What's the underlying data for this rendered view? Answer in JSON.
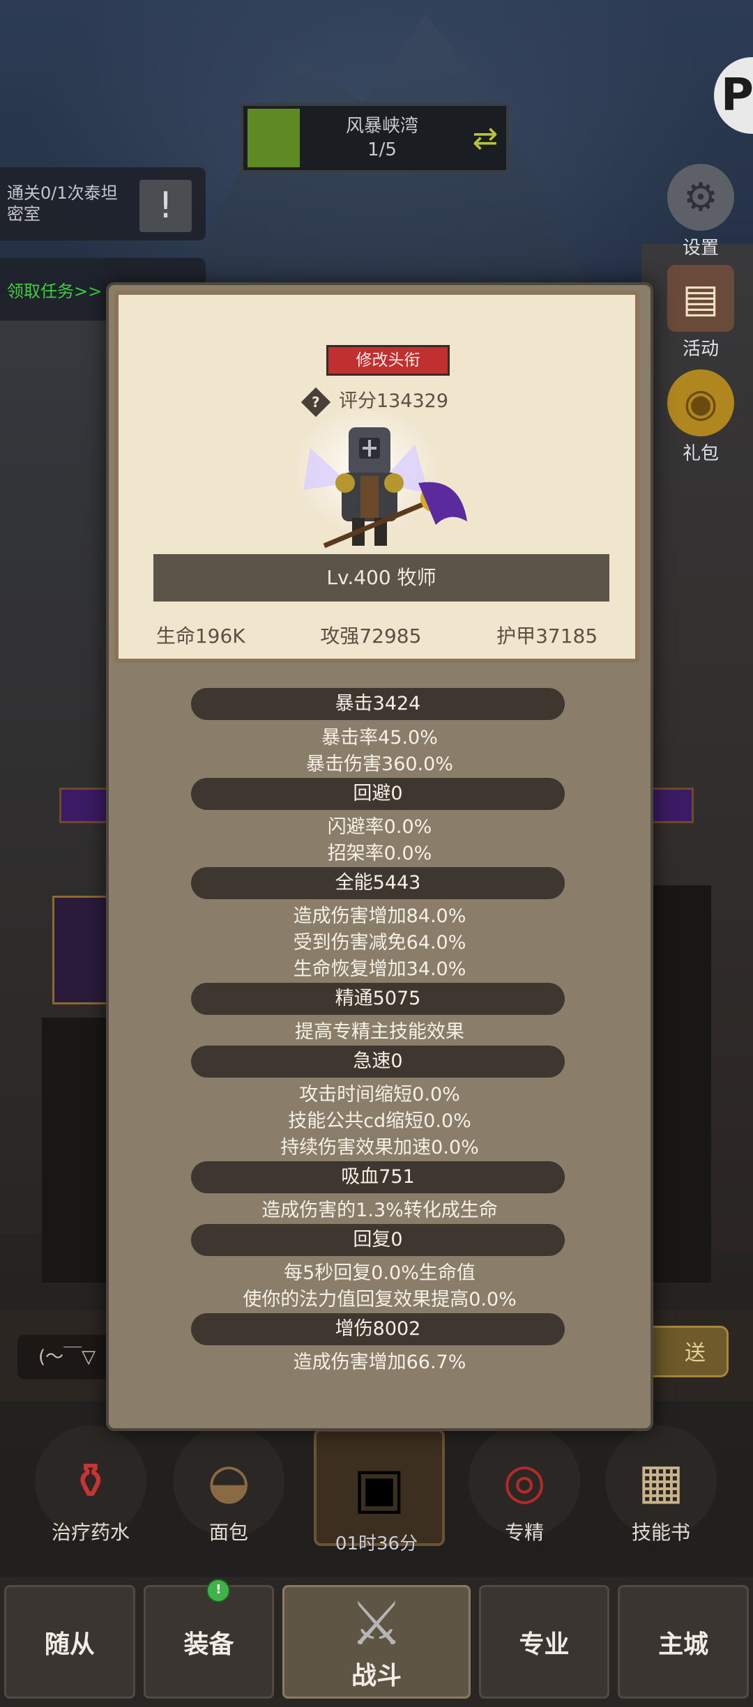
{
  "stage": {
    "name": "风暴峡湾",
    "progress": "1/5"
  },
  "quest": {
    "text": "通关0/1次泰坦密室",
    "icon": "exclamation-icon"
  },
  "task": {
    "text": "领取任务>>"
  },
  "side_menu": [
    {
      "label": "设置",
      "icon": "gear-icon"
    },
    {
      "label": "活动",
      "icon": "scroll-icon"
    },
    {
      "label": "礼包",
      "icon": "gift-icon"
    }
  ],
  "corner_badge": "P",
  "profile": {
    "title_button": "修改头衔",
    "score": "评分134329",
    "level_class": "Lv.400 牧师",
    "hp": "生命196K",
    "attack": "攻强72985",
    "armor": "护甲37185"
  },
  "sections": [
    {
      "header": "暴击3424",
      "lines": [
        "暴击率45.0%",
        "暴击伤害360.0%"
      ]
    },
    {
      "header": "回避0",
      "lines": [
        "闪避率0.0%",
        "招架率0.0%"
      ]
    },
    {
      "header": "全能5443",
      "lines": [
        "造成伤害增加84.0%",
        "受到伤害减免64.0%",
        "生命恢复增加34.0%"
      ]
    },
    {
      "header": "精通5075",
      "lines": [
        "提高专精主技能效果"
      ]
    },
    {
      "header": "急速0",
      "lines": [
        "攻击时间缩短0.0%",
        "技能公共cd缩短0.0%",
        "持续伤害效果加速0.0%"
      ]
    },
    {
      "header": "吸血751",
      "lines": [
        "造成伤害的1.3%转化成生命"
      ]
    },
    {
      "header": "回复0",
      "lines": [
        "每5秒回复0.0%生命值",
        "使你的法力值回复效果提高0.0%"
      ]
    },
    {
      "header": "增伤8002",
      "lines": [
        "造成伤害增加66.7%"
      ]
    }
  ],
  "chat": {
    "placeholder": "(～￣▽",
    "send": "送"
  },
  "items": [
    {
      "label": "治疗药水",
      "icon": "potion-icon"
    },
    {
      "label": "面包",
      "icon": "bread-icon"
    },
    {
      "label": "专精",
      "icon": "target-icon"
    },
    {
      "label": "技能书",
      "icon": "book-icon"
    }
  ],
  "chest_timer": "01时36分",
  "nav": {
    "tabs": [
      "随从",
      "装备",
      "战斗",
      "专业",
      "主城"
    ],
    "active": "战斗",
    "equip_badge": "!"
  }
}
